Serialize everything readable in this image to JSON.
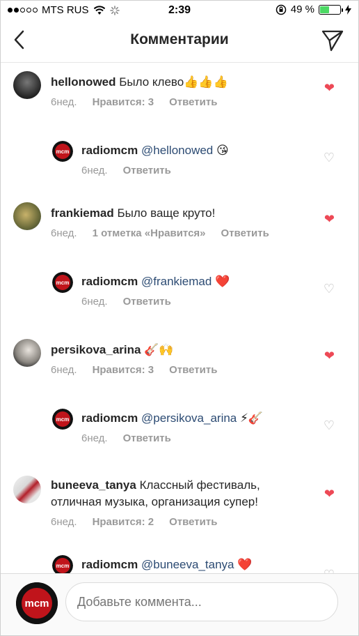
{
  "status": {
    "carrier": "MTS RUS",
    "time": "2:39",
    "battery_percent": "49 %",
    "battery_level": 0.49
  },
  "header": {
    "title": "Комментарии"
  },
  "comments": [
    {
      "user": "hellonowed",
      "text": "Было клево",
      "emoji": "👍👍👍",
      "age": "6нед.",
      "likes": "Нравится: 3",
      "reply": "Ответить",
      "liked": true
    },
    {
      "user": "radiomcm",
      "mention": "@hellonowed",
      "emoji": "😘",
      "age": "6нед.",
      "reply": "Ответить",
      "liked": false
    },
    {
      "user": "frankiemad",
      "text": "Было ваще круто!",
      "age": "6нед.",
      "likes": "1 отметка «Нравится»",
      "reply": "Ответить",
      "liked": true
    },
    {
      "user": "radiomcm",
      "mention": "@frankiemad",
      "emoji": "❤️",
      "age": "6нед.",
      "reply": "Ответить",
      "liked": false
    },
    {
      "user": "persikova_arina",
      "emoji": "🎸🙌",
      "age": "6нед.",
      "likes": "Нравится: 3",
      "reply": "Ответить",
      "liked": true
    },
    {
      "user": "radiomcm",
      "mention": "@persikova_arina",
      "emoji": "⚡🎸",
      "age": "6нед.",
      "reply": "Ответить",
      "liked": false
    },
    {
      "user": "buneeva_tanya",
      "text": "Классный фестиваль, отличная музыка, организация супер!",
      "age": "6нед.",
      "likes": "Нравится: 2",
      "reply": "Ответить",
      "liked": true
    },
    {
      "user": "radiomcm",
      "mention": "@buneeva_tanya",
      "emoji": "❤️",
      "liked": false
    }
  ],
  "composer": {
    "placeholder": "Добавьте коммента..."
  },
  "colors": {
    "heart_red": "#ed4956",
    "mention_blue": "#2c4b73",
    "battery_green": "#4cd964"
  }
}
